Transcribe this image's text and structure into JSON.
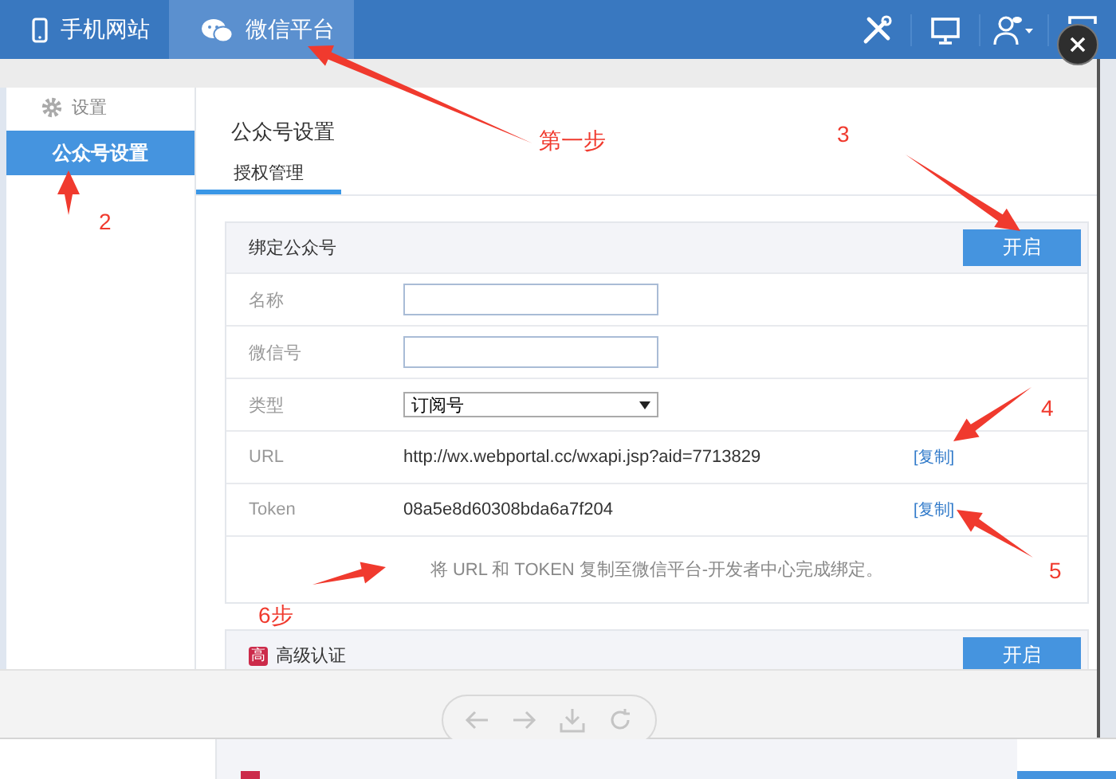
{
  "header": {
    "tabs": [
      {
        "label": "手机网站",
        "selected": false
      },
      {
        "label": "微信平台",
        "selected": true
      }
    ]
  },
  "sidebar": {
    "heading": "设置",
    "items": [
      {
        "label": "公众号设置",
        "selected": true
      }
    ]
  },
  "page": {
    "title": "公众号设置",
    "tabs": [
      {
        "label": "授权管理",
        "selected": true
      }
    ],
    "panels": [
      {
        "title": "绑定公众号",
        "button": "开启",
        "rows": [
          {
            "label": "名称",
            "kind": "input"
          },
          {
            "label": "微信号",
            "kind": "input"
          },
          {
            "label": "类型",
            "kind": "select",
            "value": "订阅号"
          },
          {
            "label": "URL",
            "kind": "text",
            "value": "http://wx.webportal.cc/wxapi.jsp?aid=7713829",
            "action": "[复制]"
          },
          {
            "label": "Token",
            "kind": "text",
            "value": "08a5e8d60308bda6a7f204",
            "action": "[复制]"
          }
        ],
        "note": "将 URL 和 TOKEN 复制至微信平台-开发者中心完成绑定。"
      },
      {
        "title": "高级认证",
        "badge": "高",
        "button": "开启"
      }
    ]
  },
  "annotations": [
    {
      "text": "第一步"
    },
    {
      "text": "3"
    },
    {
      "text": "2"
    },
    {
      "text": "4"
    },
    {
      "text": "5"
    },
    {
      "text": "6步"
    }
  ]
}
